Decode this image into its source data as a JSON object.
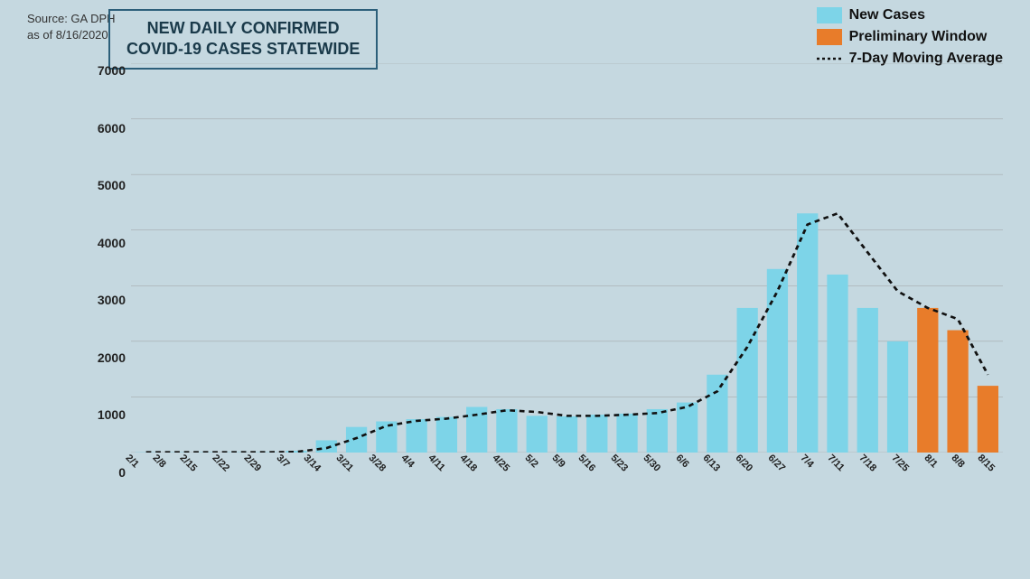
{
  "source": {
    "line1": "Source: GA DPH",
    "line2": "as of 8/16/2020"
  },
  "title": {
    "line1": "NEW DAILY CONFIRMED",
    "line2": "COVID-19 CASES STATEWIDE"
  },
  "legend": {
    "new_cases_label": "New Cases",
    "preliminary_label": "Preliminary Window",
    "moving_avg_label": "7-Day Moving Average",
    "new_cases_color": "#7dd4e8",
    "preliminary_color": "#e87c2a",
    "moving_avg_color": "#1a1a1a"
  },
  "y_axis": {
    "labels": [
      "0",
      "1000",
      "2000",
      "3000",
      "4000",
      "5000",
      "6000",
      "7000"
    ]
  },
  "x_axis": {
    "labels": [
      "2/1",
      "2/8",
      "2/15",
      "2/22",
      "2/29",
      "3/7",
      "3/14",
      "3/21",
      "3/28",
      "4/4",
      "4/11",
      "4/18",
      "4/25",
      "5/2",
      "5/9",
      "5/16",
      "5/23",
      "5/30",
      "6/6",
      "6/13",
      "6/20",
      "6/27",
      "7/4",
      "7/11",
      "7/18",
      "7/25",
      "8/1",
      "8/8",
      "8/15"
    ]
  },
  "chart": {
    "max_value": 7000,
    "bars": [
      {
        "date": "2/1",
        "value": 5,
        "type": "blue"
      },
      {
        "date": "2/8",
        "value": 5,
        "type": "blue"
      },
      {
        "date": "2/15",
        "value": 5,
        "type": "blue"
      },
      {
        "date": "2/22",
        "value": 5,
        "type": "blue"
      },
      {
        "date": "2/29",
        "value": 5,
        "type": "blue"
      },
      {
        "date": "3/7",
        "value": 30,
        "type": "blue"
      },
      {
        "date": "3/14",
        "value": 220,
        "type": "blue"
      },
      {
        "date": "3/21",
        "value": 460,
        "type": "blue"
      },
      {
        "date": "3/28",
        "value": 560,
        "type": "blue"
      },
      {
        "date": "4/4",
        "value": 600,
        "type": "blue"
      },
      {
        "date": "4/11",
        "value": 640,
        "type": "blue"
      },
      {
        "date": "4/18",
        "value": 820,
        "type": "blue"
      },
      {
        "date": "4/25",
        "value": 780,
        "type": "blue"
      },
      {
        "date": "5/2",
        "value": 660,
        "type": "blue"
      },
      {
        "date": "5/9",
        "value": 650,
        "type": "blue"
      },
      {
        "date": "5/16",
        "value": 680,
        "type": "blue"
      },
      {
        "date": "5/23",
        "value": 700,
        "type": "blue"
      },
      {
        "date": "5/30",
        "value": 780,
        "type": "blue"
      },
      {
        "date": "6/6",
        "value": 900,
        "type": "blue"
      },
      {
        "date": "6/13",
        "value": 1400,
        "type": "blue"
      },
      {
        "date": "6/20",
        "value": 2600,
        "type": "blue"
      },
      {
        "date": "6/27",
        "value": 3300,
        "type": "blue"
      },
      {
        "date": "7/4",
        "value": 4300,
        "type": "blue"
      },
      {
        "date": "7/11",
        "value": 3200,
        "type": "blue"
      },
      {
        "date": "7/18",
        "value": 2600,
        "type": "blue"
      },
      {
        "date": "7/25",
        "value": 2000,
        "type": "blue"
      },
      {
        "date": "8/1",
        "value": 2600,
        "type": "orange"
      },
      {
        "date": "8/8",
        "value": 2200,
        "type": "orange"
      },
      {
        "date": "8/15",
        "value": 1200,
        "type": "orange"
      }
    ],
    "moving_avg": [
      5,
      5,
      5,
      5,
      5,
      12,
      80,
      260,
      480,
      570,
      610,
      680,
      760,
      730,
      660,
      660,
      680,
      710,
      820,
      1100,
      1900,
      2900,
      4100,
      4300,
      3600,
      2900,
      2600,
      2400,
      1400
    ]
  }
}
